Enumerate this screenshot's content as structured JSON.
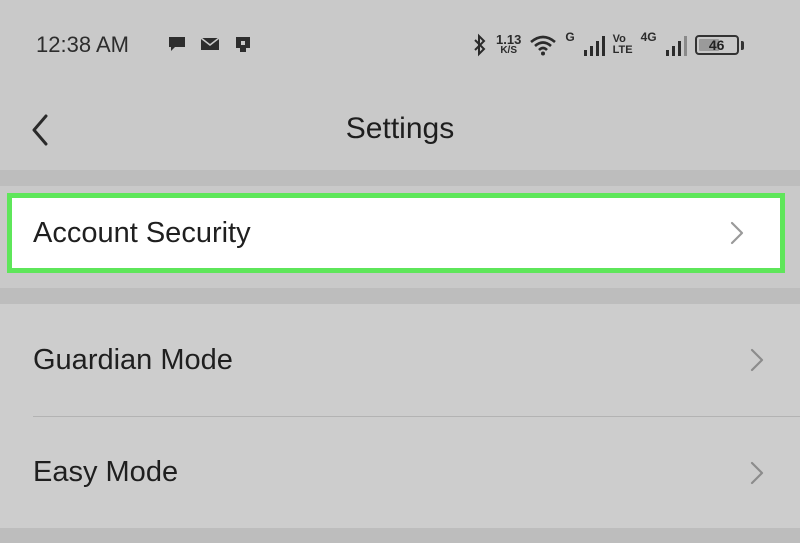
{
  "status_bar": {
    "time": "12:38 AM",
    "notification_icons": [
      "chat-bubble-icon",
      "mail-icon",
      "sim-card-icon"
    ],
    "network_speed_value": "1.13",
    "network_speed_unit": "K/S",
    "signal_1_label": "G",
    "volte_top": "Vo",
    "volte_bottom": "LTE",
    "signal_2_label": "4G",
    "battery_level": "46"
  },
  "header": {
    "title": "Settings",
    "back_icon": "chevron-left-icon"
  },
  "settings": {
    "items": [
      {
        "label": "Account Security",
        "highlighted": true
      },
      {
        "label": "Guardian Mode"
      },
      {
        "label": "Easy Mode"
      }
    ]
  },
  "colors": {
    "highlight_border": "#5ee65a",
    "background": "#c9c9c9"
  }
}
